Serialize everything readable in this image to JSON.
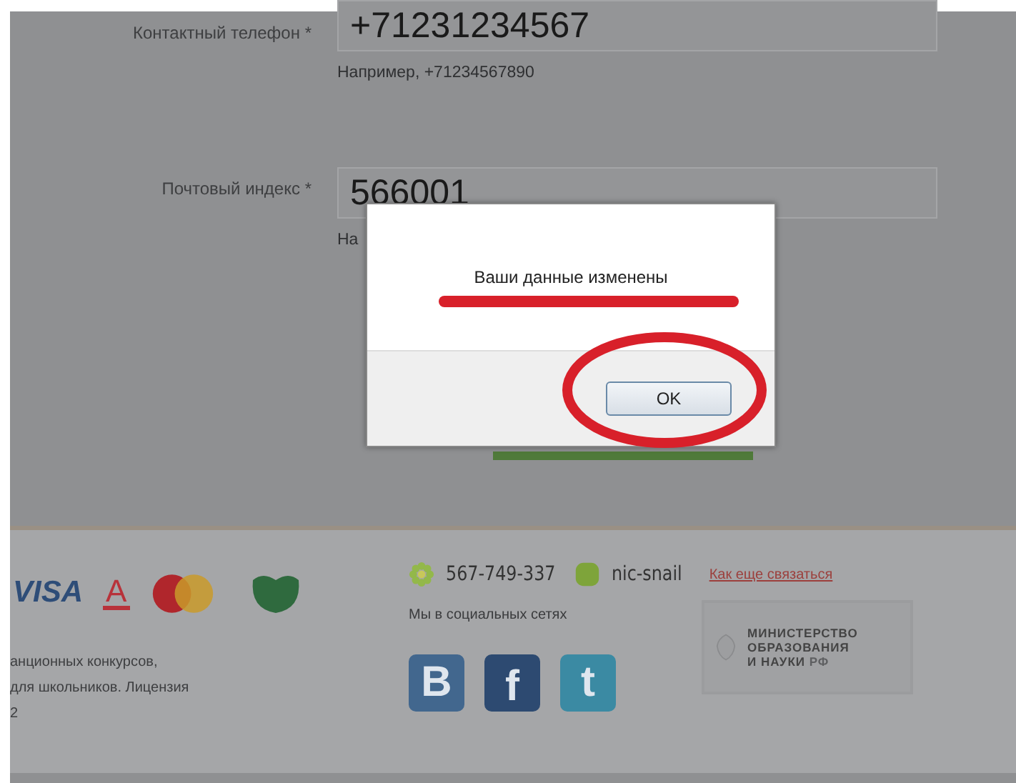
{
  "form": {
    "fields": [
      {
        "label": "Контактный телефон *",
        "value": "+71231234567",
        "hint": "Например, +71234567890"
      },
      {
        "label": "Почтовый индекс *",
        "value": "566001",
        "hint": "На"
      }
    ]
  },
  "dialog": {
    "message": "Ваши данные изменены",
    "button": "OK"
  },
  "footer": {
    "payment": {
      "visa": "VISA",
      "alfa": "A"
    },
    "contacts": [
      {
        "kind": "icq",
        "text": "567-749-337"
      },
      {
        "kind": "skype",
        "text": "nic-snail"
      }
    ],
    "contact_link": "Как еще связаться",
    "social_title": "Мы в социальных сетях",
    "social": [
      {
        "kind": "vk",
        "text": "B"
      },
      {
        "kind": "fb",
        "text": "f"
      },
      {
        "kind": "tw",
        "text": "t"
      }
    ],
    "ministry": [
      "МИНИСТЕРСТВО",
      "ОБРАЗОВАНИЯ",
      "И НАУКИ **РФ**"
    ],
    "about": [
      "анционных конкурсов,",
      "для школьников. Лицензия",
      "2"
    ]
  }
}
